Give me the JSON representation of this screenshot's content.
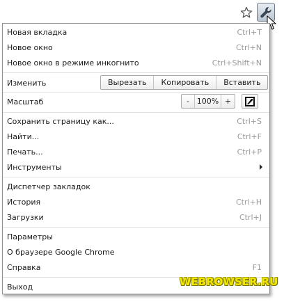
{
  "toolbar": {
    "star_icon": "star-outline-icon",
    "wrench_icon": "wrench-icon"
  },
  "menu": {
    "new_tab": {
      "label": "Новая вкладка",
      "shortcut": "Ctrl+T"
    },
    "new_window": {
      "label": "Новое окно",
      "shortcut": "Ctrl+N"
    },
    "new_incognito": {
      "label": "Новое окно в режиме инкогнито",
      "shortcut": "Ctrl+Shift+N"
    },
    "edit": {
      "label": "Изменить",
      "cut": "Вырезать",
      "copy": "Копировать",
      "paste": "Вставить"
    },
    "zoom": {
      "label": "Масштаб",
      "minus": "-",
      "value": "100%",
      "plus": "+"
    },
    "save_page": {
      "label": "Сохранить страницу как...",
      "shortcut": "Ctrl+S"
    },
    "find": {
      "label": "Найти...",
      "shortcut": "Ctrl+F"
    },
    "print": {
      "label": "Печать...",
      "shortcut": "Ctrl+P"
    },
    "tools": {
      "label": "Инструменты"
    },
    "bookmark_manager": {
      "label": "Диспетчер закладок"
    },
    "history": {
      "label": "История",
      "shortcut": "Ctrl+H"
    },
    "downloads": {
      "label": "Загрузки",
      "shortcut": "Ctrl+J"
    },
    "settings": {
      "label": "Параметры"
    },
    "about": {
      "label": "О браузере Google Chrome"
    },
    "help": {
      "label": "Справка",
      "shortcut": "F1"
    },
    "exit": {
      "label": "Выход"
    }
  },
  "watermark": "WEBROWSER.RU",
  "colors": {
    "shortcut_text": "#9a9a9a",
    "separator": "#e3e3e3",
    "watermark": "#f2e600"
  }
}
